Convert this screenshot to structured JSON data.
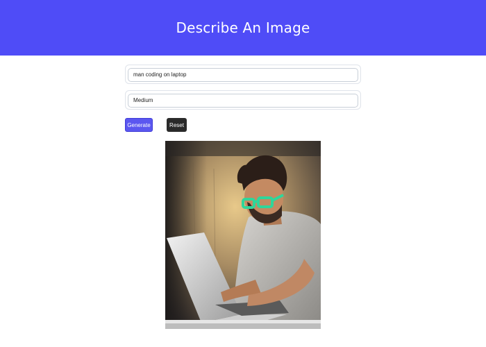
{
  "header": {
    "title": "Describe An Image",
    "background_color": "#4f4cf7"
  },
  "form": {
    "prompt": {
      "value": "man coding on laptop"
    },
    "size": {
      "value": "Medium"
    }
  },
  "buttons": {
    "generate_label": "Generate",
    "reset_label": "Reset",
    "generate_color": "#5b57f0",
    "reset_color": "#2a2a2a"
  },
  "result_image": {
    "alt": "generated image: man with green glasses typing on a laptop"
  }
}
